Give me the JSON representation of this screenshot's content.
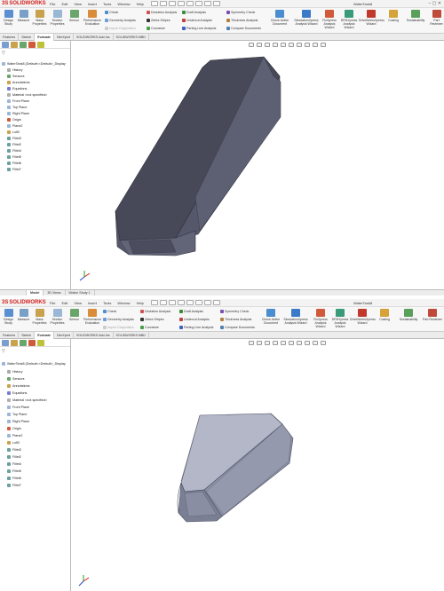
{
  "app": {
    "logo_ds": "3S",
    "logo_text": "SOLIDWORKS",
    "menu": [
      "File",
      "Edit",
      "View",
      "Insert",
      "Tools",
      "Window",
      "Help"
    ],
    "window_title": "WaterTank8",
    "win_controls": "– ▢ ✕"
  },
  "ribbon": {
    "design_study": "Design Study",
    "measure": "Measure",
    "mass_properties": "Mass Properties",
    "section_properties": "Section Properties",
    "sensor": "Sensor",
    "performance_evaluation": "Performance Evaluation",
    "check": "Check",
    "geometry_analysis": "Geometry Analysis",
    "import_diagnostics": "Import Diagnostics",
    "deviation_analysis": "Deviation Analysis",
    "zebra_stripes": "Zebra Stripes",
    "curvature": "Curvature",
    "draft_analysis": "Draft Analysis",
    "undercut_analysis": "Undercut Analysis",
    "parting_line_analysis": "Parting Line Analysis",
    "symmetry_check": "Symmetry Check",
    "thickness_analysis": "Thickness Analysis",
    "compare_documents": "Compare Documents",
    "check_active_document": "Check Active Document",
    "simulationxpress": "SimulationXpress Analysis Wizard",
    "floxpress": "FloXpress Analysis Wizard",
    "dfmxpress": "DFMXpress Analysis Wizard",
    "driveworksxpress": "DriveWorksXpress Wizard",
    "costing": "Costing",
    "sustainability": "Sustainability",
    "part_reviewer": "Part Reviewer"
  },
  "tabs_top": [
    "Features",
    "Sketch",
    "Evaluate",
    "DimXpert",
    "SOLIDWORKS Add-Ins",
    "SOLIDWORKS MBD"
  ],
  "tabs_bot": [
    "Features",
    "Sketch",
    "Evaluate",
    "DimXpert",
    "SOLIDWORKS Add-Ins",
    "SOLIDWORKS MBD"
  ],
  "tree": {
    "root_top": "WaterTank8 (Default<<Default>_Display",
    "root_bot": "WaterTank8 (Default<<Default>_Display",
    "items": [
      "History",
      "Sensors",
      "Annotations",
      "Equations",
      "Material <not specified>",
      "Front Plane",
      "Top Plane",
      "Right Plane",
      "Origin",
      "Plane2",
      "Loft2",
      "Fillet3",
      "Fillet2",
      "Fillet4",
      "Fillet5",
      "Fillet6",
      "Fillet7"
    ],
    "filter_icon": "filter"
  },
  "bottom_tabs": [
    "Model",
    "3D Views",
    "Motion Study 1"
  ],
  "colors": {
    "accent": "#d2201d",
    "body_face": "#4a4c5c",
    "body_side": "#6b6d7e",
    "body_light_top": "#b9bccb",
    "body_light_side": "#8e92a6"
  }
}
